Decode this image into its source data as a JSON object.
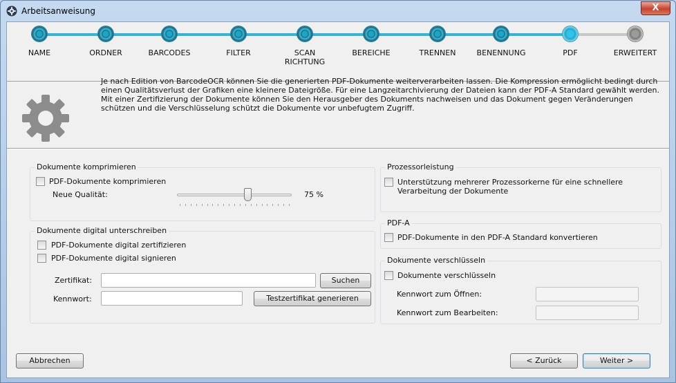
{
  "window": {
    "title": "Arbeitsanweisung",
    "close_glyph": "X"
  },
  "steps": [
    {
      "label": "NAME",
      "state": "done"
    },
    {
      "label": "ORDNER",
      "state": "done"
    },
    {
      "label": "BARCODES",
      "state": "done"
    },
    {
      "label": "FILTER",
      "state": "done"
    },
    {
      "label": "SCAN\nRICHTUNG",
      "state": "done"
    },
    {
      "label": "BEREICHE",
      "state": "done"
    },
    {
      "label": "TRENNEN",
      "state": "done"
    },
    {
      "label": "BENENNUNG",
      "state": "done"
    },
    {
      "label": "PDF",
      "state": "active"
    },
    {
      "label": "ERWEITERT",
      "state": "todo"
    }
  ],
  "colors": {
    "step_done": "#1aa7c7",
    "step_line_done": "#2fb6d8",
    "step_line_todo": "#c8c8c8"
  },
  "info": {
    "icon": "gear-icon",
    "text": "Je nach Edition von BarcodeOCR können Sie die generierten PDF-Dokumente weiterverarbeiten lassen. Die Kompression ermöglicht bedingt durch einen Qualitätsverlust der Grafiken eine kleinere Dateigröße. Für eine Langzeitarchivierung der Dateien kann der PDF-A Standard gewählt werden. Mit einer Zertifizierung der Dokumente können Sie den Herausgeber des Dokuments nachweisen und das Dokument gegen Veränderungen schützen und die Verschlüsselung schützt die Dokumente vor unbefugtem Zugriff."
  },
  "compress": {
    "title": "Dokumente komprimieren",
    "checkbox_label": "PDF-Dokumente komprimieren",
    "checked": false,
    "quality_label": "Neue Qualität:",
    "quality_value": 75,
    "quality_text": "75 %"
  },
  "sign": {
    "title": "Dokumente digital unterschreiben",
    "certify_label": "PDF-Dokumente digital zertifizieren",
    "sign_label": "PDF-Dokumente digital signieren",
    "certificate_label": "Zertifikat:",
    "certificate_value": "",
    "search_button": "Suchen",
    "password_label": "Kennwort:",
    "password_value": "",
    "generate_button": "Testzertifikat generieren"
  },
  "cpu": {
    "title": "Prozessorleistung",
    "checkbox_label_line1": "Unterstützung mehrerer Prozessorkerne für eine schnellere",
    "checkbox_label_line2": "Verarbeitung der Dokumente"
  },
  "pdfa": {
    "title": "PDF-A",
    "checkbox_label": "PDF-Dokumente in den PDF-A Standard konvertieren"
  },
  "encrypt": {
    "title": "Dokumente verschlüsseln",
    "checkbox_label": "Dokumente verschlüsseln",
    "open_password_label": "Kennwort zum Öffnen:",
    "edit_password_label": "Kennwort zum Bearbeiten:"
  },
  "footer": {
    "cancel": "Abbrechen",
    "back": "< Zurück",
    "next": "Weiter >"
  }
}
